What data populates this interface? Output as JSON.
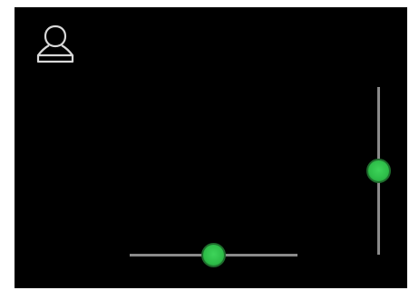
{
  "screen": {
    "background": "#000000",
    "user_icon": {
      "icon": "user-icon",
      "color": "#d8d8d8"
    },
    "horizontal_slider": {
      "value": 0.5,
      "track_color": "#8a8a8a",
      "thumb_color": "#2dbd48"
    },
    "vertical_slider": {
      "value": 0.5,
      "track_color": "#8a8a8a",
      "thumb_color": "#2dbd48"
    }
  }
}
